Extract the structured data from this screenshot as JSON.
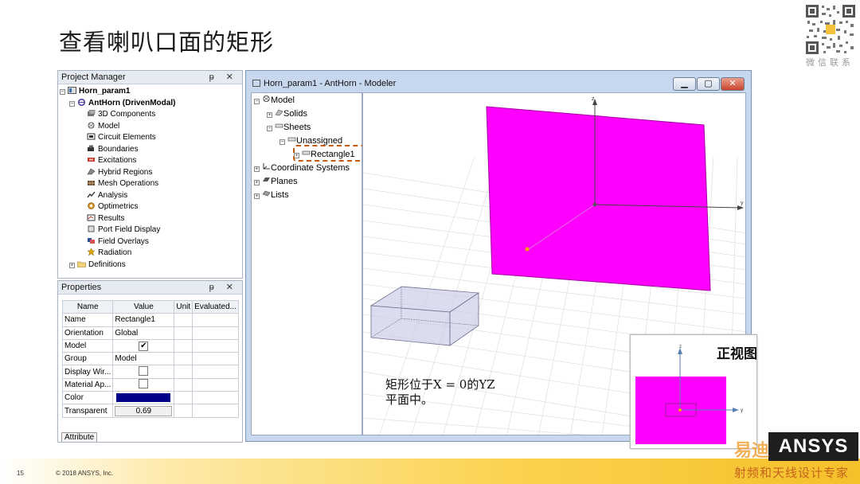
{
  "slide": {
    "title": "查看喇叭口面的矩形",
    "qr_caption": "微信联系",
    "annotation_line1": "矩形位于X = 0的YZ",
    "annotation_line2": "平面中。",
    "inset_label": "正视图",
    "page_number": "15",
    "copyright": "© 2018 ANSYS, Inc.",
    "logo_text": "ANSYS",
    "watermark_top": "易迪",
    "watermark_bottom": "射频和天线设计专家"
  },
  "project_manager": {
    "title": "Project Manager",
    "controls": "ᵽ ✕",
    "root": "Horn_param1",
    "design": "AntHorn (DrivenModal)",
    "items": [
      "3D Components",
      "Model",
      "Circuit Elements",
      "Boundaries",
      "Excitations",
      "Hybrid Regions",
      "Mesh Operations",
      "Analysis",
      "Optimetrics",
      "Results",
      "Port Field Display",
      "Field Overlays",
      "Radiation"
    ],
    "definitions": "Definitions"
  },
  "properties": {
    "title": "Properties",
    "controls": "ᵽ ✕",
    "headers": [
      "Name",
      "Value",
      "Unit",
      "Evaluated..."
    ],
    "rows": [
      {
        "name": "Name",
        "value": "Rectangle1"
      },
      {
        "name": "Orientation",
        "value": "Global"
      },
      {
        "name": "Model",
        "value": "✔"
      },
      {
        "name": "Group",
        "value": "Model"
      },
      {
        "name": "Display Wir...",
        "value": ""
      },
      {
        "name": "Material Ap...",
        "value": ""
      },
      {
        "name": "Color",
        "value": ""
      },
      {
        "name": "Transparent",
        "value": "0.69"
      }
    ],
    "tab": "Attribute"
  },
  "modeler": {
    "title": "Horn_param1 - AntHorn - Modeler",
    "min": "▁",
    "max": "▢",
    "close": "✕",
    "tree": {
      "model": "Model",
      "solids": "Solids",
      "sheets": "Sheets",
      "unassigned": "Unassigned",
      "rectangle": "Rectangle1",
      "cs": "Coordinate Systems",
      "planes": "Planes",
      "lists": "Lists"
    },
    "axis_z": "z",
    "axis_y": "y"
  },
  "colors": {
    "rectangle_fill": "#ff00ff",
    "color_swatch": "#00008b",
    "footer_accent": "#fbd24e"
  }
}
